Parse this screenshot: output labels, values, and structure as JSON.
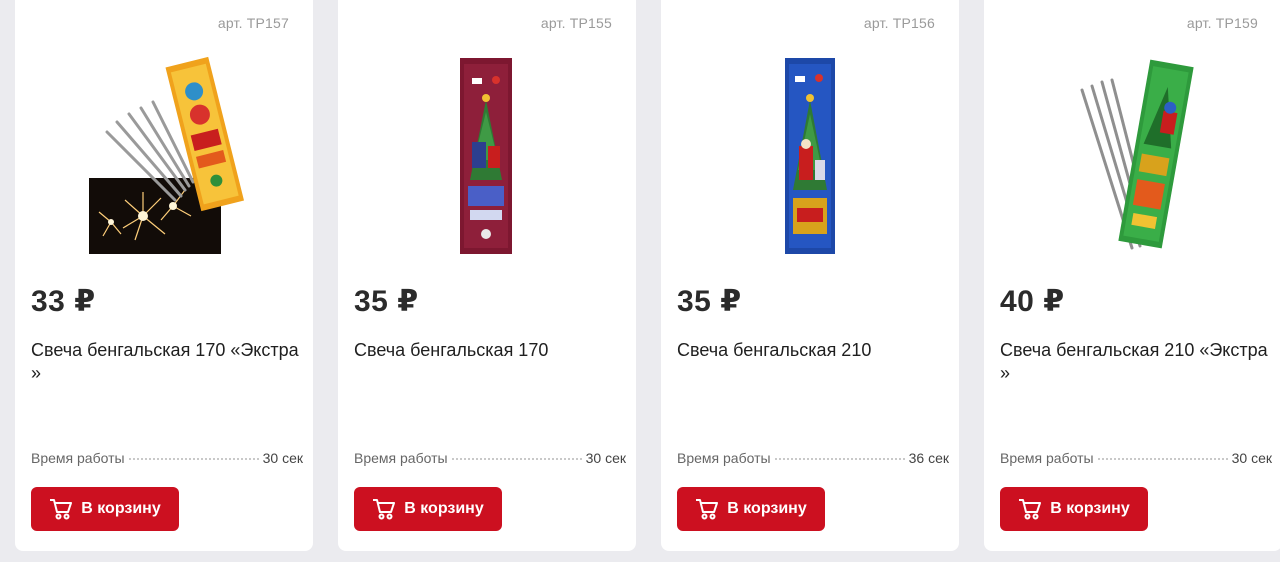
{
  "products": [
    {
      "sku": "арт. ТР157",
      "price": "33 ₽",
      "title": "Свеча бенгальская 170 «Экстра »",
      "spec_label": "Время работы",
      "spec_value": "30 сек",
      "button_label": "В корзину",
      "package_color": "#f0a21c"
    },
    {
      "sku": "арт. ТР155",
      "price": "35 ₽",
      "title": "Свеча бенгальская 170",
      "spec_label": "Время работы",
      "spec_value": "30 сек",
      "button_label": "В корзину",
      "package_color": "#7d1730"
    },
    {
      "sku": "арт. ТР156",
      "price": "35 ₽",
      "title": "Свеча бенгальская 210",
      "spec_label": "Время работы",
      "spec_value": "36 сек",
      "button_label": "В корзину",
      "package_color": "#1d48a8"
    },
    {
      "sku": "арт. ТР159",
      "price": "40 ₽",
      "title": "Свеча бенгальская 210 «Экстра »",
      "spec_label": "Время работы",
      "spec_value": "30 сек",
      "button_label": "В корзину",
      "package_color": "#2e9a3c"
    }
  ],
  "colors": {
    "accent": "#cc1020",
    "background": "#ebebef"
  }
}
